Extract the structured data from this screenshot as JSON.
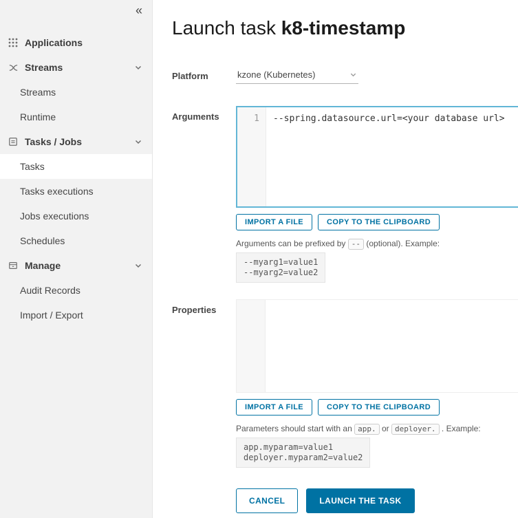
{
  "sidebar": {
    "collapse_glyph": "«",
    "sections": [
      {
        "label": "Applications",
        "icon": "applications-grid-icon",
        "children": []
      },
      {
        "label": "Streams",
        "icon": "streams-icon",
        "children": [
          "Streams",
          "Runtime"
        ]
      },
      {
        "label": "Tasks / Jobs",
        "icon": "tasks-jobs-icon",
        "children": [
          "Tasks",
          "Tasks executions",
          "Jobs executions",
          "Schedules"
        ],
        "active_child": "Tasks"
      },
      {
        "label": "Manage",
        "icon": "manage-icon",
        "children": [
          "Audit Records",
          "Import / Export"
        ]
      }
    ]
  },
  "main": {
    "title_prefix": "Launch task",
    "title_name": "k8-timestamp",
    "platform": {
      "label": "Platform",
      "value": "kzone (Kubernetes)"
    },
    "arguments": {
      "label": "Arguments",
      "line_number": "1",
      "code": "--spring.datasource.url=<your database url>",
      "import_button": "IMPORT A FILE",
      "copy_button": "COPY TO THE CLIPBOARD",
      "help_prefix": "Arguments can be prefixed by",
      "help_chip": "--",
      "help_suffix": "(optional). Example:",
      "example": "--myarg1=value1\n--myarg2=value2"
    },
    "properties": {
      "label": "Properties",
      "import_button": "IMPORT A FILE",
      "copy_button": "COPY TO THE CLIPBOARD",
      "help_prefix": "Parameters should start with an",
      "help_chip1": "app.",
      "help_middle": "or",
      "help_chip2": "deployer.",
      "help_suffix": ". Example:",
      "example": "app.myparam=value1\ndeployer.myparam2=value2"
    },
    "cancel_button": "CANCEL",
    "launch_button": "LAUNCH THE TASK"
  },
  "colors": {
    "primary": "#0072a3",
    "sidebar_bg": "#f2f2f2",
    "editor_focus_border": "#62b6d6",
    "gutter_bg": "#f7f7f7"
  }
}
